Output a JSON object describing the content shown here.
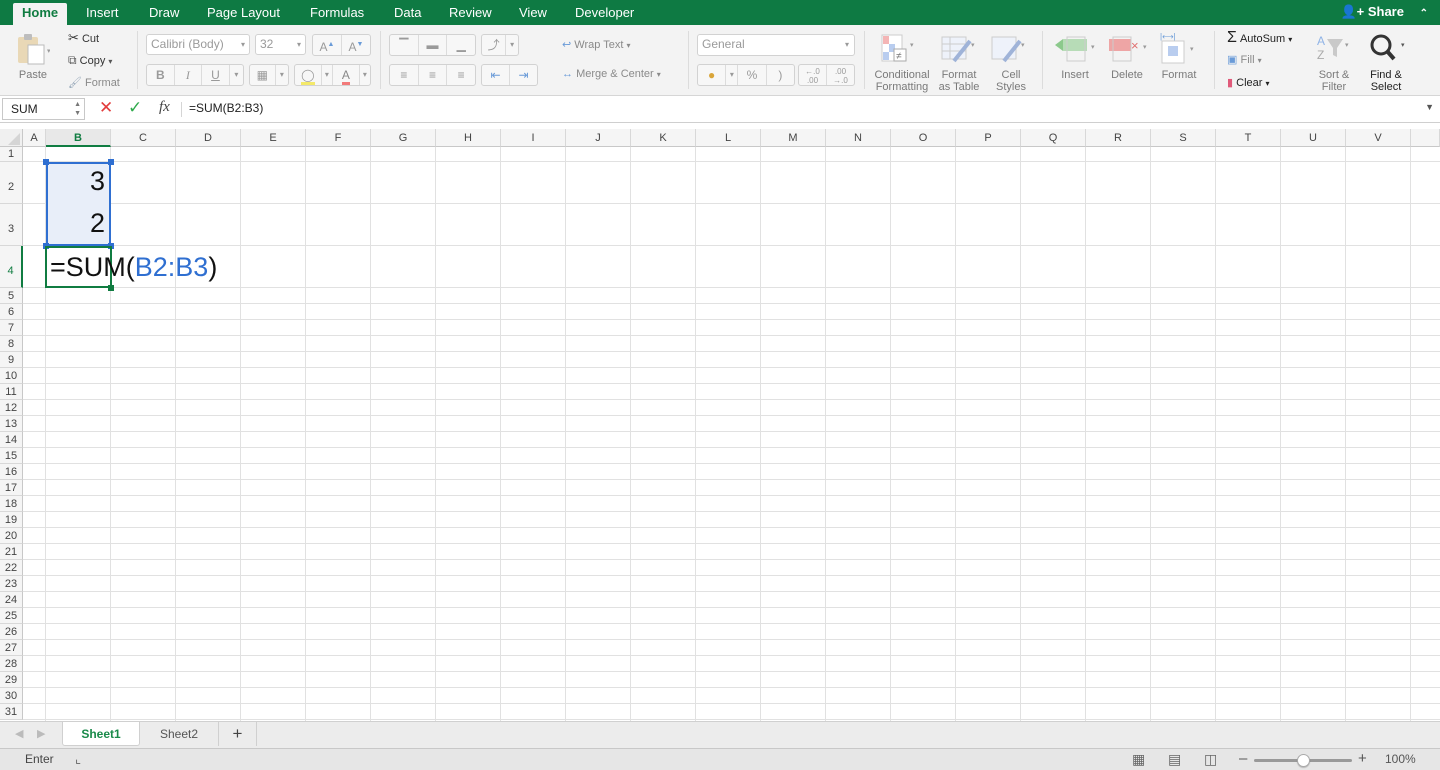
{
  "ribbon_tabs": [
    {
      "label": "Home",
      "active": true
    },
    {
      "label": "Insert"
    },
    {
      "label": "Draw"
    },
    {
      "label": "Page Layout"
    },
    {
      "label": "Formulas"
    },
    {
      "label": "Data"
    },
    {
      "label": "Review"
    },
    {
      "label": "View"
    },
    {
      "label": "Developer"
    }
  ],
  "share_label": "Share",
  "clipboard": {
    "paste": "Paste",
    "cut": "Cut",
    "copy": "Copy",
    "format": "Format"
  },
  "font": {
    "name": "Calibri (Body)",
    "size": "32",
    "bold": "B",
    "italic": "I",
    "underline": "U",
    "grow": "A",
    "shrink": "A",
    "font_color": "A"
  },
  "alignment": {
    "wrap_text": "Wrap Text",
    "merge_center": "Merge & Center"
  },
  "number": {
    "format": "General",
    "percent": "%",
    "comma": ")",
    "inc_decimal": ".0\n.00",
    "dec_decimal": ".00\n.0"
  },
  "styles": {
    "conditional_formatting_1": "Conditional",
    "conditional_formatting_2": "Formatting",
    "format_table_1": "Format",
    "format_table_2": "as Table",
    "cell_styles_1": "Cell",
    "cell_styles_2": "Styles"
  },
  "cells": {
    "insert": "Insert",
    "delete": "Delete",
    "format": "Format"
  },
  "editing": {
    "autosum": "AutoSum",
    "fill": "Fill",
    "clear": "Clear",
    "sort_filter_1": "Sort &",
    "sort_filter_2": "Filter",
    "find_select_1": "Find &",
    "find_select_2": "Select"
  },
  "formula_bar": {
    "name_box": "SUM",
    "cancel": "✕",
    "enter": "✓",
    "fx": "fx",
    "formula": "=SUM(B2:B3)"
  },
  "columns": [
    "A",
    "B",
    "C",
    "D",
    "E",
    "F",
    "G",
    "H",
    "I",
    "J",
    "K",
    "L",
    "M",
    "N",
    "O",
    "P",
    "Q",
    "R",
    "S",
    "T",
    "U",
    "V"
  ],
  "selected_column": "B",
  "rows": [
    "1",
    "2",
    "3",
    "4",
    "5",
    "6",
    "7",
    "8",
    "9",
    "10",
    "11",
    "12",
    "13",
    "14",
    "15",
    "16",
    "17",
    "18",
    "19",
    "20",
    "21",
    "22",
    "23",
    "24",
    "25",
    "26",
    "27",
    "28",
    "29",
    "30",
    "31"
  ],
  "selected_row": "4",
  "cell_values": {
    "B2": "3",
    "B3": "2",
    "B4_prefix": "=SUM(",
    "B4_ref": "B2:B3",
    "B4_suffix": ")"
  },
  "colors": {
    "accent": "#107c41",
    "ref_blue": "#2f6fd1",
    "range_fill": "#e8eef9",
    "cancel_red": "#e23c3c",
    "enter_green": "#2faa4c"
  },
  "sheets": [
    {
      "label": "Sheet1",
      "active": true
    },
    {
      "label": "Sheet2"
    }
  ],
  "add_sheet": "+",
  "status": {
    "mode": "Enter",
    "zoom": "100%",
    "zoom_level": 1.0
  }
}
